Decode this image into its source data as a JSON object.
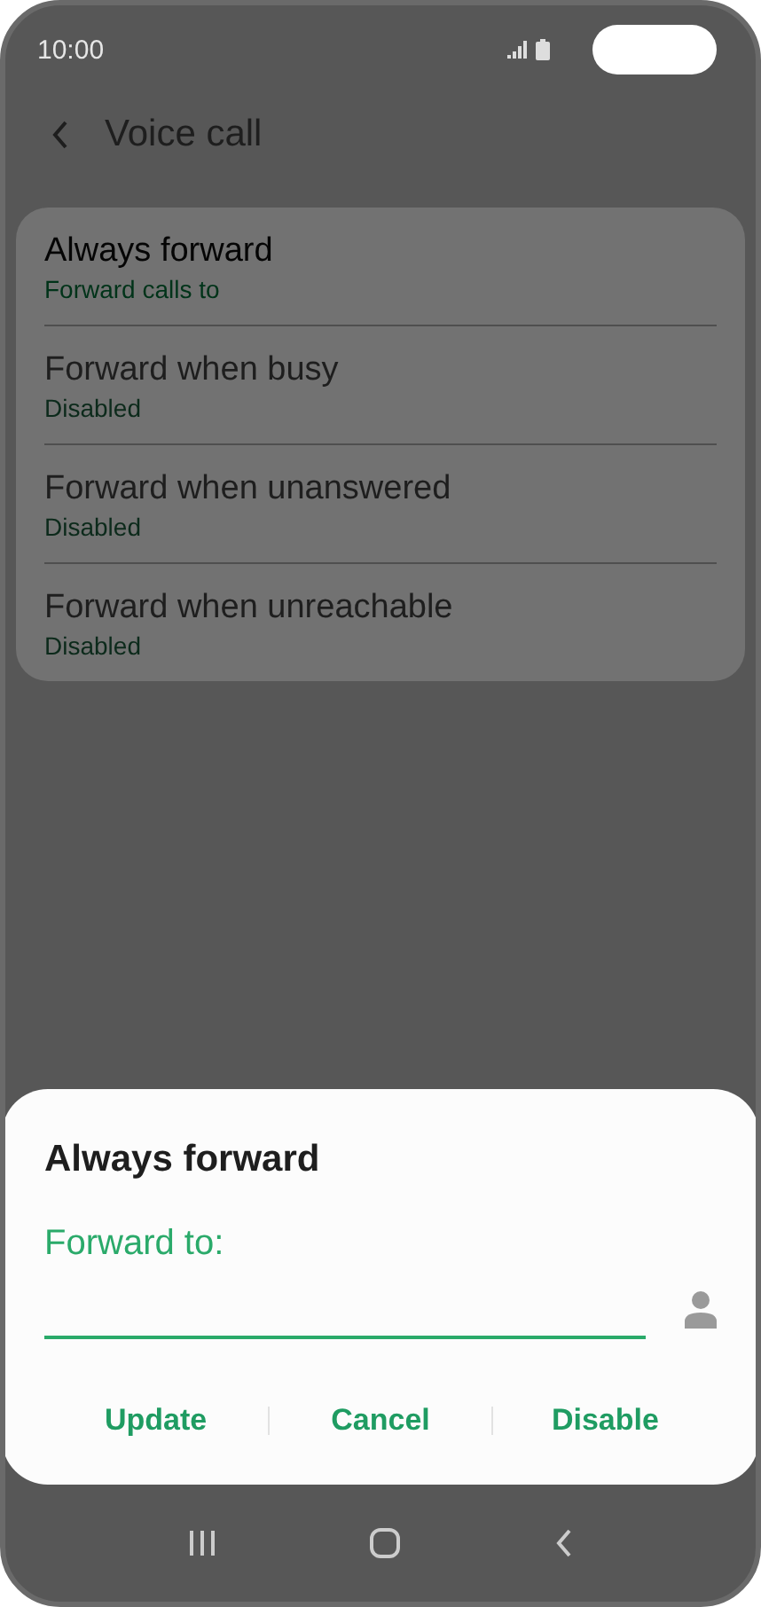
{
  "status_bar": {
    "time": "10:00"
  },
  "header": {
    "title": "Voice call"
  },
  "settings": [
    {
      "title": "Always forward",
      "summary": "Forward calls to",
      "disabled": false
    },
    {
      "title": "Forward when busy",
      "summary": "Disabled",
      "disabled": true
    },
    {
      "title": "Forward when unanswered",
      "summary": "Disabled",
      "disabled": true
    },
    {
      "title": "Forward when unreachable",
      "summary": "Disabled",
      "disabled": true
    }
  ],
  "dialog": {
    "title": "Always forward",
    "label": "Forward to:",
    "buttons": [
      "Update",
      "Cancel",
      "Disable"
    ]
  }
}
